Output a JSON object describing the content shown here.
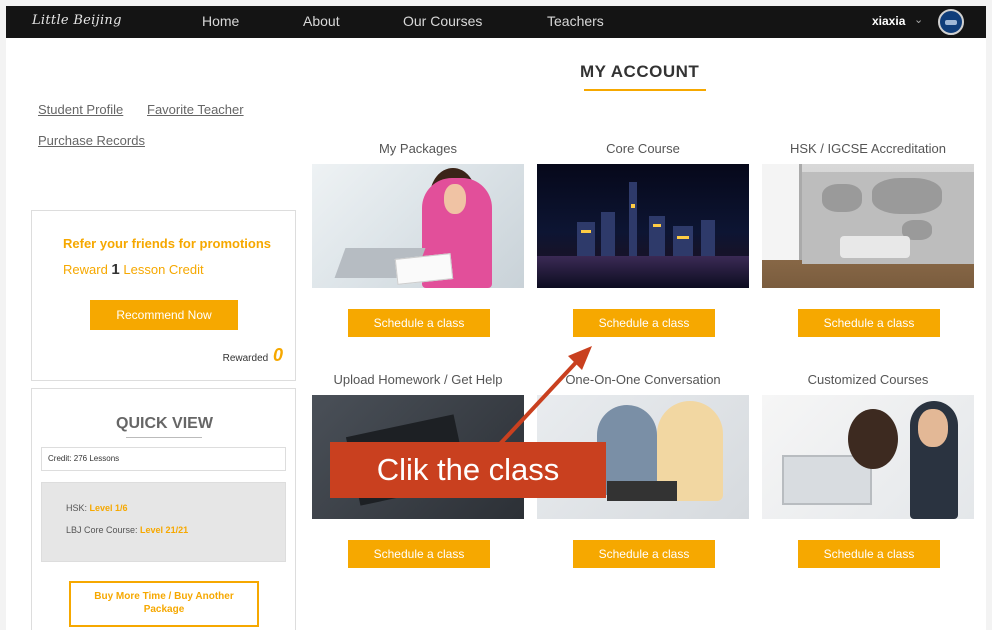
{
  "nav": {
    "logo": "Little Beijing",
    "links": [
      "Home",
      "About",
      "Our Courses",
      "Teachers"
    ],
    "user": "xiaxia"
  },
  "page_title": "MY ACCOUNT",
  "left_links": {
    "student_profile": "Student Profile",
    "favorite_teacher": "Favorite Teacher",
    "purchase_records": "Purchase Records"
  },
  "referral": {
    "title": "Refer your friends for promotions",
    "reward_prefix": "Reward",
    "reward_count": "1",
    "reward_suffix": "Lesson Credit",
    "button": "Recommend Now",
    "rewarded_label": "Rewarded",
    "rewarded_value": "0"
  },
  "quick_view": {
    "title": "QUICK VIEW",
    "credit": "Credit: 276 Lessons",
    "hsk_label": "HSK:",
    "hsk_value": "Level 1/6",
    "core_label": "LBJ Core Course:",
    "core_value": "Level 21/21",
    "buy_line1": "Buy More Time / Buy Another",
    "buy_line2": "Package"
  },
  "cards": [
    {
      "title": "My Packages",
      "button": "Schedule a class"
    },
    {
      "title": "Core Course",
      "button": "Schedule a class"
    },
    {
      "title": "HSK / IGCSE Accreditation",
      "button": "Schedule a class"
    },
    {
      "title": "Upload Homework / Get Help",
      "button": "Schedule a class"
    },
    {
      "title": "One-On-One Conversation",
      "button": "Schedule a class"
    },
    {
      "title": "Customized Courses",
      "button": "Schedule a class"
    }
  ],
  "annotation": {
    "text": "Clik the class",
    "color": "#c9401f"
  },
  "colors": {
    "accent": "#f6a800",
    "nav_bg": "#141414"
  }
}
